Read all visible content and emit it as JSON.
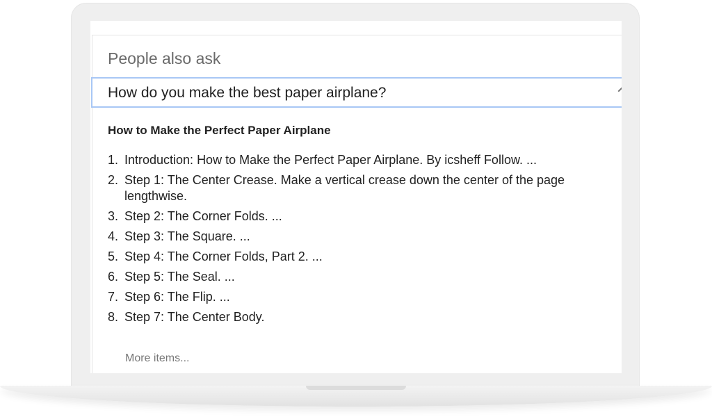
{
  "people_also_ask": {
    "heading": "People also ask",
    "question": "How do you make the best paper airplane?",
    "answer": {
      "title": "How to Make the Perfect Paper Airplane",
      "steps": [
        {
          "num": "1.",
          "text": "Introduction: How to Make the Perfect Paper Airplane. By icsheff Follow. ..."
        },
        {
          "num": "2.",
          "text": "Step 1: The Center Crease. Make a vertical crease down the center of the page lengthwise."
        },
        {
          "num": "3.",
          "text": "Step 2: The Corner Folds. ..."
        },
        {
          "num": "4.",
          "text": "Step 3: The Square. ..."
        },
        {
          "num": "5.",
          "text": "Step 4: The Corner Folds, Part 2. ..."
        },
        {
          "num": "6.",
          "text": "Step 5: The Seal. ..."
        },
        {
          "num": "7.",
          "text": "Step 6: The Flip. ..."
        },
        {
          "num": "8.",
          "text": "Step 7: The Center Body."
        }
      ],
      "more_label": "More items..."
    }
  },
  "icons": {
    "toggle": "chevron-up-icon"
  },
  "colors": {
    "focus_border": "#a8c7f5",
    "heading_text": "#6a6a6a",
    "muted_text": "#777777"
  }
}
